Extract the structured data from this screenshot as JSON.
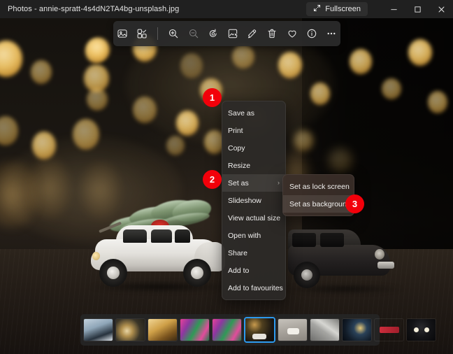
{
  "window": {
    "title": "Photos - annie-spratt-4s4dN2TA4bg-unsplash.jpg",
    "fullscreen_label": "Fullscreen",
    "minimize_tooltip": "Minimize",
    "maximize_tooltip": "Maximize",
    "close_tooltip": "Close"
  },
  "toolbar": {
    "buttons": [
      {
        "name": "view-image-icon",
        "label": "View image"
      },
      {
        "name": "multi-select-icon",
        "label": "Multi-select"
      },
      {
        "name": "zoom-in-icon",
        "label": "Zoom in"
      },
      {
        "name": "zoom-out-icon",
        "label": "Zoom out"
      },
      {
        "name": "rotate-icon",
        "label": "Rotate"
      },
      {
        "name": "crop-edit-icon",
        "label": "Edit image"
      },
      {
        "name": "markup-pen-icon",
        "label": "Markup"
      },
      {
        "name": "delete-icon",
        "label": "Delete"
      },
      {
        "name": "favorite-heart-icon",
        "label": "Add to favourites"
      },
      {
        "name": "info-icon",
        "label": "File info"
      },
      {
        "name": "more-options-icon",
        "label": "See more"
      }
    ]
  },
  "context_menu": {
    "items": [
      {
        "label": "Save as",
        "has_submenu": false
      },
      {
        "label": "Print",
        "has_submenu": false
      },
      {
        "label": "Copy",
        "has_submenu": false
      },
      {
        "label": "Resize",
        "has_submenu": false
      },
      {
        "label": "Set as",
        "has_submenu": true,
        "submenu_arrow": "›",
        "highlighted": true
      },
      {
        "label": "Slideshow",
        "has_submenu": false
      },
      {
        "label": "View actual size",
        "has_submenu": false
      },
      {
        "label": "Open with",
        "has_submenu": false
      },
      {
        "label": "Share",
        "has_submenu": false
      },
      {
        "label": "Add to",
        "has_submenu": false
      },
      {
        "label": "Add to favourites",
        "has_submenu": false
      }
    ]
  },
  "submenu": {
    "items": [
      {
        "label": "Set as lock screen",
        "highlighted": false
      },
      {
        "label": "Set as background",
        "highlighted": true
      }
    ]
  },
  "badges": [
    {
      "number": "1",
      "color": "#f2000a"
    },
    {
      "number": "2",
      "color": "#f2000a"
    },
    {
      "number": "3",
      "color": "#f2000a"
    }
  ],
  "filmstrip": {
    "selected_index": 5,
    "thumbnails": [
      {
        "name": "thumb-snow-building",
        "c1": "#9bb4c8",
        "c2": "#2c3c4c",
        "c3": "#d5dde6"
      },
      {
        "name": "thumb-bokeh-ornament",
        "c1": "#c9a86a",
        "c2": "#2b2b24",
        "c3": "#e8d8ae"
      },
      {
        "name": "thumb-gold-lights",
        "c1": "#d9a64a",
        "c2": "#6d4d1e",
        "c3": "#f3d38a"
      },
      {
        "name": "thumb-pink-neon-a",
        "c1": "#e33d8f",
        "c2": "#2a8a4f",
        "c3": "#f06fb0"
      },
      {
        "name": "thumb-pink-neon-b",
        "c1": "#e33d8f",
        "c2": "#2a8a4f",
        "c3": "#f06fb0"
      },
      {
        "name": "thumb-christmas-car",
        "c1": "#3a2f22",
        "c2": "#0f0d0b",
        "c3": "#e0ddd6"
      },
      {
        "name": "thumb-white-car",
        "c1": "#b9b5ae",
        "c2": "#8d8882",
        "c3": "#efece6"
      },
      {
        "name": "thumb-grey-texture",
        "c1": "#9a9a98",
        "c2": "#5e5e5c",
        "c3": "#c9c9c6"
      },
      {
        "name": "thumb-city-night",
        "c1": "#1b2a3a",
        "c2": "#0a1018",
        "c3": "#e4c271"
      },
      {
        "name": "thumb-neon-sign",
        "c1": "#0d2b4a",
        "c2": "#07182c",
        "c3": "#d82a3c"
      },
      {
        "name": "thumb-dark-lamps",
        "c1": "#17171a",
        "c2": "#0a0a0c",
        "c3": "#f0ead6"
      }
    ]
  },
  "photo": {
    "description": "Toy white Volkswagen Beetle carrying a Christmas tree on a wooden table with warm bokeh lights"
  }
}
